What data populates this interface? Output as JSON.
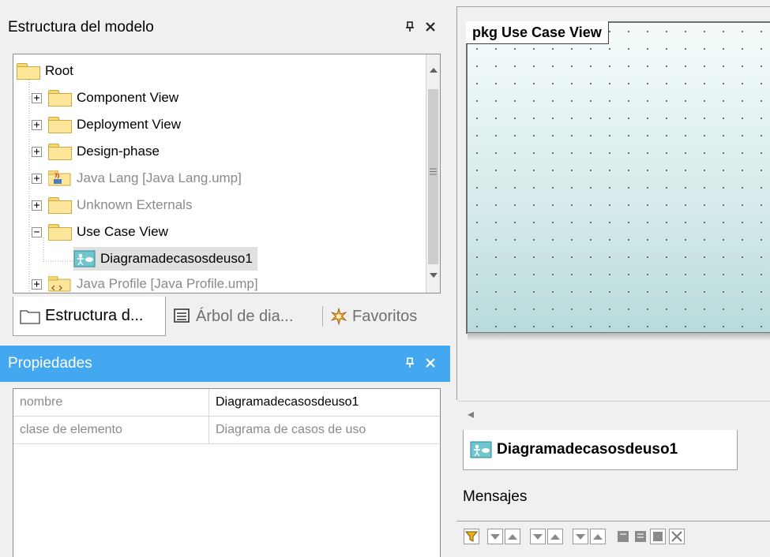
{
  "model_panel": {
    "title": "Estructura del modelo",
    "pin_glyph": "Ԃ─",
    "close_glyph": "✕",
    "tree": [
      {
        "label": "Root",
        "icon": "folder-icon",
        "expander": "",
        "dim": false
      },
      {
        "label": "Component View",
        "icon": "folder-icon",
        "expander": "+",
        "dim": false
      },
      {
        "label": "Deployment View",
        "icon": "folder-icon",
        "expander": "+",
        "dim": false
      },
      {
        "label": "Design-phase",
        "icon": "folder-icon",
        "expander": "+",
        "dim": false
      },
      {
        "label": "Java Lang [Java Lang.ump]",
        "icon": "java-icon",
        "expander": "+",
        "dim": true
      },
      {
        "label": "Unknown Externals",
        "icon": "folder-icon",
        "expander": "+",
        "dim": true
      },
      {
        "label": "Use Case View",
        "icon": "folder-icon",
        "expander": "−",
        "dim": false
      },
      {
        "label": "Diagramadecasosdeuso1",
        "icon": "use-case-diagram-icon",
        "expander": "",
        "dim": false,
        "selected": true
      },
      {
        "label": "Java Profile [Java Profile.ump]",
        "icon": "profile-icon",
        "expander": "+",
        "dim": true
      }
    ],
    "tabs": [
      {
        "label": "Estructura d...",
        "icon": "folder-outline-icon",
        "active": true
      },
      {
        "label": "Árbol de dia...",
        "icon": "diagram-tree-icon",
        "active": false
      },
      {
        "label": "Favoritos",
        "icon": "favorites-icon",
        "active": false
      }
    ]
  },
  "properties_panel": {
    "title": "Propiedades",
    "pin_glyph": "Ԃ─",
    "close_glyph": "✕",
    "rows": [
      {
        "key": "nombre",
        "value": "Diagramadecasosdeuso1",
        "value_dim": false
      },
      {
        "key": "clase de elemento",
        "value": "Diagrama de casos de uso",
        "value_dim": true
      }
    ]
  },
  "diagram": {
    "package_label": "pkg Use Case View",
    "tab_label": "Diagramadecasosdeuso1",
    "scroll_left_glyph": "◂"
  },
  "messages": {
    "title": "Mensajes",
    "toolbar": [
      "filter-icon",
      "prev-error-icon",
      "next-error-icon",
      "prev-warning-icon",
      "next-warning-icon",
      "prev-info-icon",
      "next-info-icon",
      "copy-icon",
      "copy-all-icon",
      "copy-selected-icon",
      "clear-icon"
    ]
  }
}
